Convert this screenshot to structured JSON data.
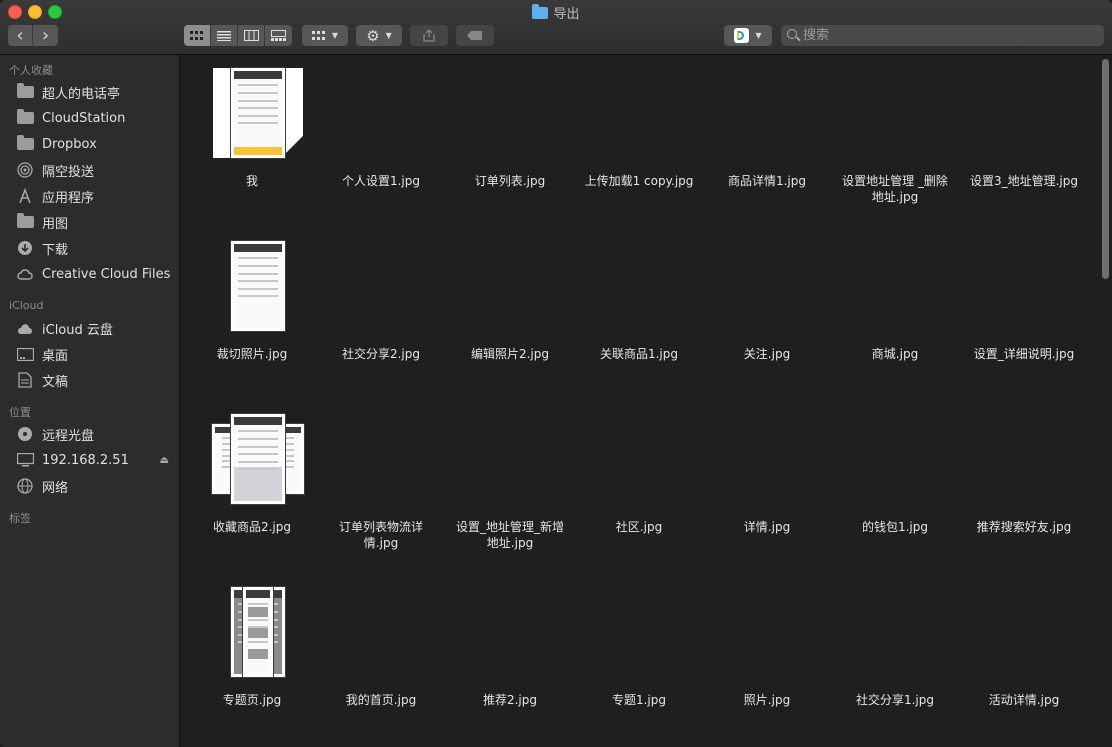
{
  "window": {
    "title": "导出"
  },
  "toolbar": {
    "back": "‹",
    "forward": "›",
    "search_placeholder": "搜索",
    "share_icon": "share-icon",
    "tag_icon": "tag-icon"
  },
  "sidebar": {
    "favorites_header": "个人收藏",
    "favorites": [
      {
        "label": "超人的电话亭",
        "icon": "folder-icon"
      },
      {
        "label": "CloudStation",
        "icon": "folder-icon"
      },
      {
        "label": "Dropbox",
        "icon": "folder-icon"
      },
      {
        "label": "隔空投送",
        "icon": "airdrop-icon"
      },
      {
        "label": "应用程序",
        "icon": "applications-icon"
      },
      {
        "label": "用图",
        "icon": "folder-icon"
      },
      {
        "label": "下载",
        "icon": "download-icon"
      },
      {
        "label": "Creative Cloud Files",
        "icon": "creative-cloud-icon"
      }
    ],
    "icloud_header": "iCloud",
    "icloud": [
      {
        "label": "iCloud 云盘",
        "icon": "cloud-icon"
      },
      {
        "label": "桌面",
        "icon": "desktop-icon"
      },
      {
        "label": "文稿",
        "icon": "document-icon"
      }
    ],
    "locations_header": "位置",
    "locations": [
      {
        "label": "远程光盘",
        "icon": "disc-icon"
      },
      {
        "label": "192.168.2.51",
        "icon": "computer-icon"
      },
      {
        "label": "网络",
        "icon": "network-icon"
      }
    ],
    "tags_header": "标签"
  },
  "files": [
    {
      "name": "我"
    },
    {
      "name": "个人设置1.jpg"
    },
    {
      "name": "订单列表.jpg"
    },
    {
      "name": "上传加载1 copy.jpg"
    },
    {
      "name": "商品详情1.jpg"
    },
    {
      "name": "设置地址管理 _删除地址.jpg"
    },
    {
      "name": "设置3_地址管理.jpg"
    },
    {
      "name": "裁切照片.jpg"
    },
    {
      "name": "社交分享2.jpg"
    },
    {
      "name": "编辑照片2.jpg"
    },
    {
      "name": "关联商品1.jpg"
    },
    {
      "name": "关注.jpg"
    },
    {
      "name": "商城.jpg"
    },
    {
      "name": "设置_详细说明.jpg"
    },
    {
      "name": "收藏商品2.jpg"
    },
    {
      "name": "订单列表物流详情.jpg"
    },
    {
      "name": "设置_地址管理_新增地址.jpg"
    },
    {
      "name": "社区.jpg"
    },
    {
      "name": "详情.jpg"
    },
    {
      "name": "的钱包1.jpg"
    },
    {
      "name": "推荐搜索好友.jpg"
    },
    {
      "name": "专题页.jpg"
    },
    {
      "name": "我的首页.jpg"
    },
    {
      "name": "推荐2.jpg"
    },
    {
      "name": "专题1.jpg"
    },
    {
      "name": "照片.jpg"
    },
    {
      "name": "社交分享1.jpg"
    },
    {
      "name": "活动详情.jpg"
    }
  ]
}
